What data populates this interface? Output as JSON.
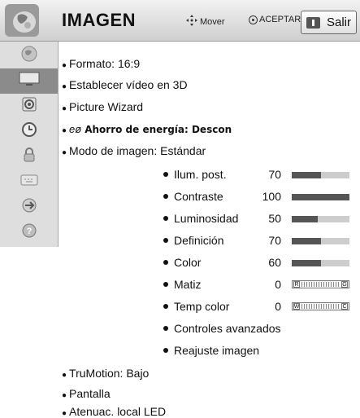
{
  "header": {
    "title": "IMAGEN",
    "hint_move": "Mover",
    "hint_ok": "ACEPTAR",
    "exit_label": "Salir"
  },
  "sidebar": {
    "items": [
      {
        "icon": "globe-icon"
      },
      {
        "icon": "tv-icon",
        "active": true
      },
      {
        "icon": "speaker-icon"
      },
      {
        "icon": "clock-icon"
      },
      {
        "icon": "lock-icon"
      },
      {
        "icon": "keyboard-icon"
      },
      {
        "icon": "usb-icon"
      },
      {
        "icon": "help-icon"
      }
    ]
  },
  "menu": {
    "formato": "Formato: 16:9",
    "video3d": "Establecer vídeo en 3D",
    "wizard": "Picture Wizard",
    "energy_icon": "eø",
    "energy": "Ahorro de energía: Descon",
    "modo": "Modo de imagen: Estándar",
    "trumotion": "TruMotion: Bajo",
    "pantalla": "Pantalla",
    "atenuac": "Atenuac. local LED"
  },
  "settings": {
    "ilum": {
      "label": "Ilum. post.",
      "value": "70",
      "level": 0.5
    },
    "contraste": {
      "label": "Contraste",
      "value": "100",
      "level": 1.0
    },
    "luminosidad": {
      "label": "Luminosidad",
      "value": "50",
      "level": 0.45
    },
    "definicion": {
      "label": "Definición",
      "value": "70",
      "level": 0.5
    },
    "color": {
      "label": "Color",
      "value": "60",
      "level": 0.5
    },
    "matiz": {
      "label": "Matiz",
      "value": "0",
      "left": "R",
      "right": "G"
    },
    "temp": {
      "label": "Temp color",
      "value": "0",
      "left": "W",
      "right": "C"
    },
    "avanzados": "Controles avanzados",
    "reajuste": "Reajuste imagen"
  },
  "colors": {
    "bar_fill": "#555555",
    "bar_track": "#cdcdcd",
    "active_tab": "#8b8b8b"
  }
}
